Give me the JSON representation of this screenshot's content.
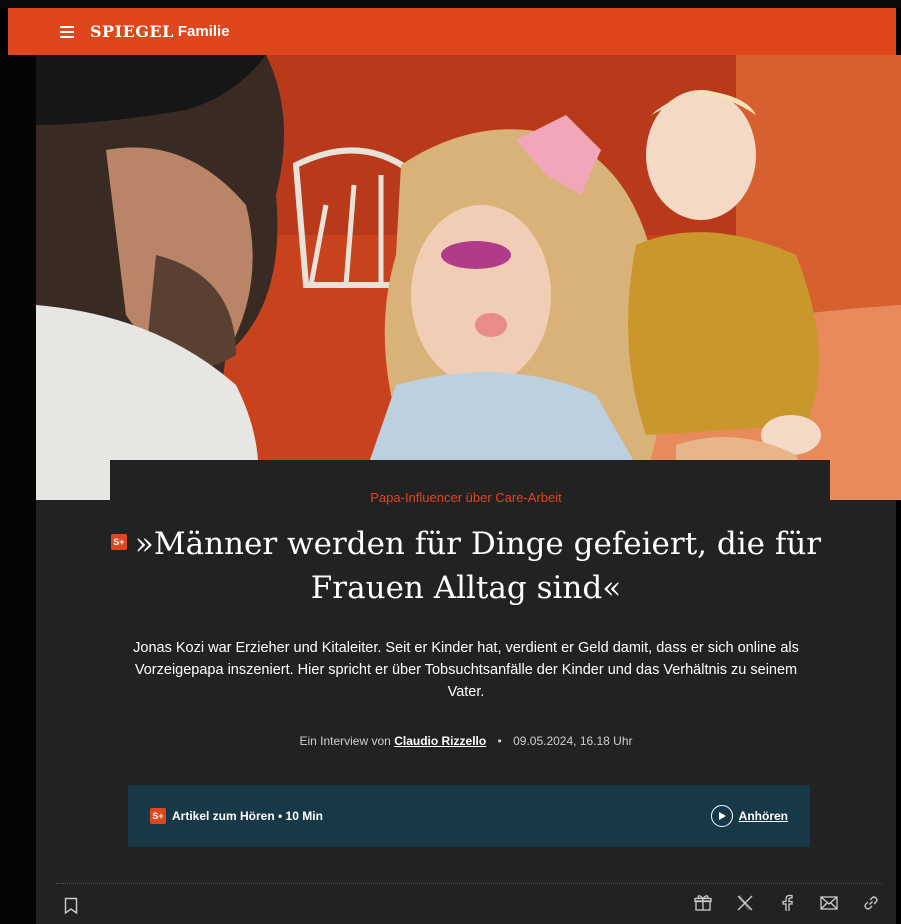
{
  "header": {
    "logo": "SPIEGEL",
    "section": "Familie",
    "accent_color": "#e0461e"
  },
  "hero": {
    "icon": "photo"
  },
  "article": {
    "kicker": "Papa-Influencer über Care-Arbeit",
    "plus_badge": "S+",
    "title_line1": "»Männer werden für Dinge gefeiert, die für",
    "title_line2": "Frauen Alltag sind«",
    "teaser": "Jonas Kozi war Erzieher und Kitaleiter. Seit er Kinder hat, verdient er Geld damit, dass er sich online als Vorzeigepapa inszeniert. Hier spricht er über Tobsuchtsanfälle der Kinder und das Verhältnis zu seinem Vater.",
    "byline_prefix": "Ein Interview von",
    "author": "Claudio Rizzello",
    "date": "09.05.2024, 16.18 Uhr"
  },
  "audio": {
    "badge": "S+",
    "label": "Artikel zum Hören • 10 Min",
    "listen_label": "Anhören",
    "background_color": "#173846"
  },
  "toolbar": {
    "bookmark_icon": "bookmark-icon",
    "share_icons": [
      "gift-icon",
      "x-icon",
      "facebook-icon",
      "mail-icon",
      "link-icon"
    ]
  }
}
